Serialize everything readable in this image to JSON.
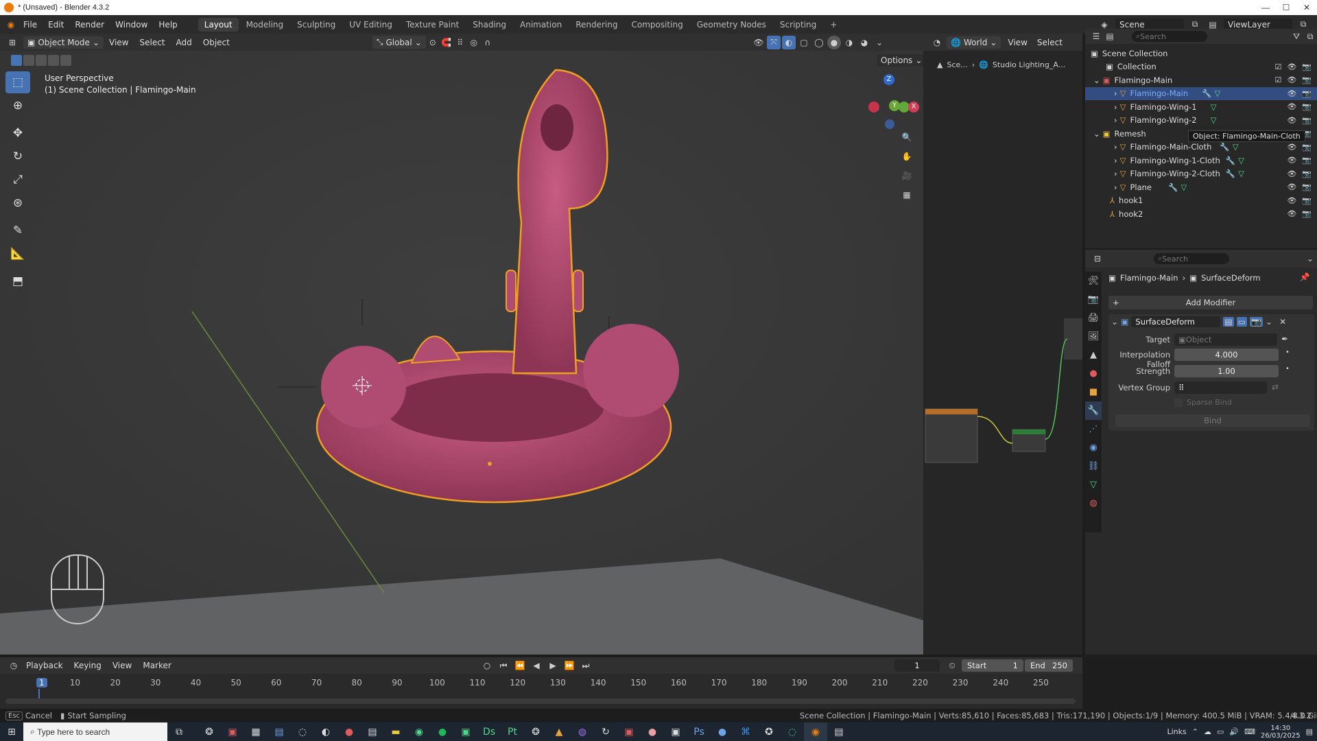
{
  "window": {
    "title": "* (Unsaved) - Blender 4.3.2",
    "min": "—",
    "max": "☐",
    "close": "✕"
  },
  "menu": {
    "items": [
      "File",
      "Edit",
      "Render",
      "Window",
      "Help"
    ]
  },
  "workspaces": [
    "Layout",
    "Modeling",
    "Sculpting",
    "UV Editing",
    "Texture Paint",
    "Shading",
    "Animation",
    "Rendering",
    "Compositing",
    "Geometry Nodes",
    "Scripting"
  ],
  "active_workspace": "Layout",
  "scene": {
    "label": "Scene",
    "viewlayer": "ViewLayer"
  },
  "viewport": {
    "mode": "Object Mode",
    "menus": [
      "View",
      "Select",
      "Add",
      "Object"
    ],
    "orientation": "Global",
    "options": "Options",
    "info_line1": "User Perspective",
    "info_line2": "(1) Scene Collection | Flamingo-Main",
    "gizmo": {
      "z": "Z",
      "y": "Y",
      "x": "X"
    }
  },
  "node_header": {
    "world": "World",
    "view": "View",
    "select": "Select",
    "crumb1": "Sce...",
    "crumb2": "Studio Lighting_A..."
  },
  "outliner": {
    "search_placeholder": "Search",
    "tooltip": "Object: Flamingo-Main-Cloth",
    "rows": [
      {
        "label": "Scene Collection",
        "indent": 0,
        "icon": "collection",
        "color": "#cfcfcf"
      },
      {
        "label": "Collection",
        "indent": 1,
        "icon": "collection",
        "color": "#cfcfcf"
      },
      {
        "label": "Flamingo-Main",
        "indent": 1,
        "icon": "collection",
        "color": "#e05c5c",
        "expanded": true
      },
      {
        "label": "Flamingo-Main",
        "indent": 2,
        "icon": "mesh",
        "color": "#e8a33d",
        "selected": true
      },
      {
        "label": "Flamingo-Wing-1",
        "indent": 2,
        "icon": "mesh",
        "color": "#e8a33d"
      },
      {
        "label": "Flamingo-Wing-2",
        "indent": 2,
        "icon": "mesh",
        "color": "#e8a33d"
      },
      {
        "label": "Remesh",
        "indent": 1,
        "icon": "collection",
        "color": "#e8c93d",
        "expanded": true
      },
      {
        "label": "Flamingo-Main-Cloth",
        "indent": 2,
        "icon": "mesh",
        "color": "#e8a33d"
      },
      {
        "label": "Flamingo-Wing-1-Cloth",
        "indent": 2,
        "icon": "mesh",
        "color": "#e8a33d"
      },
      {
        "label": "Flamingo-Wing-2-Cloth",
        "indent": 2,
        "icon": "mesh",
        "color": "#e8a33d"
      },
      {
        "label": "Plane",
        "indent": 2,
        "icon": "mesh",
        "color": "#e8a33d"
      },
      {
        "label": "hook1",
        "indent": 1,
        "icon": "empty",
        "color": "#e8a33d"
      },
      {
        "label": "hook2",
        "indent": 1,
        "icon": "empty",
        "color": "#e8a33d"
      }
    ]
  },
  "properties": {
    "search_placeholder": "Search",
    "crumb_object": "Flamingo-Main",
    "crumb_modifier": "SurfaceDeform",
    "add_modifier": "Add Modifier",
    "modifier_name": "SurfaceDeform",
    "target_label": "Target",
    "target_placeholder": "Object",
    "falloff_label": "Interpolation Falloff",
    "falloff_value": "4.000",
    "strength_label": "Strength",
    "strength_value": "1.00",
    "vgroup_label": "Vertex Group",
    "sparse_label": "Sparse Bind",
    "bind_label": "Bind"
  },
  "timeline": {
    "menus": [
      "Playback",
      "Keying",
      "View",
      "Marker"
    ],
    "current_frame": "1",
    "start_label": "Start",
    "start": "1",
    "end_label": "End",
    "end": "250",
    "ticks": [
      "1",
      "10",
      "20",
      "30",
      "40",
      "50",
      "60",
      "70",
      "80",
      "90",
      "100",
      "110",
      "120",
      "130",
      "140",
      "150",
      "160",
      "170",
      "180",
      "190",
      "200",
      "210",
      "220",
      "230",
      "240",
      "250"
    ]
  },
  "status": {
    "esc": "Esc",
    "cancel": "Cancel",
    "sampling": "Start Sampling",
    "stats": "Scene Collection | Flamingo-Main | Verts:85,610 | Faces:85,683 | Tris:171,190 | Objects:1/9 | Memory: 400.5 MiB | VRAM: 5.4/8.0 GiB",
    "version": "4.3.2"
  },
  "taskbar": {
    "search": "Type here to search",
    "links": "Links",
    "time": "14:30",
    "date": "26/03/2025"
  },
  "colors": {
    "flamingo": "#b84e72",
    "outline": "#f0a020",
    "accent": "#4772b3"
  }
}
